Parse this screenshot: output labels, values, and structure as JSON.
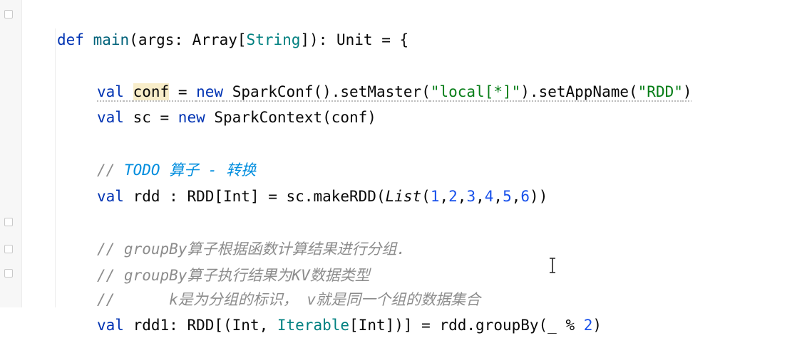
{
  "editor": {
    "line1": {
      "kw_def": "def",
      "name": "main",
      "rest1": "(args: Array[",
      "type_string": "String",
      "rest2": "]): Unit = {"
    },
    "line2": {
      "kw_val": "val",
      "var": "conf",
      "eq": " = ",
      "kw_new": "new",
      "call1": " SparkConf().setMaster(",
      "str1": "\"local[*]\"",
      "call2": ").setAppName(",
      "str2": "\"RDD\"",
      "close": ")"
    },
    "line3": {
      "kw_val": "val",
      "mid": " sc = ",
      "kw_new": "new",
      "rest": " SparkContext(conf)"
    },
    "line4": {
      "slash": "// ",
      "todo": "TODO 算子 - 转换"
    },
    "line5": {
      "kw_val": "val",
      "mid": " rdd : RDD[Int] = sc.makeRDD(",
      "list": "List",
      "open": "(",
      "nums": [
        "1",
        "2",
        "3",
        "4",
        "5",
        "6"
      ],
      "close": "))"
    },
    "line6": {
      "comment": "// groupBy算子根据函数计算结果进行分组."
    },
    "line7": {
      "comment": "// groupBy算子执行结果为KV数据类型"
    },
    "line8": {
      "comment": "//      k是为分组的标识， v就是同一个组的数据集合"
    },
    "line9": {
      "kw_val": "val",
      "mid": " rdd1: RDD[(Int, ",
      "iterable": "Iterable",
      "rest": "[Int])] = rdd.groupBy(_ % ",
      "num": "2",
      "close": ")"
    }
  },
  "icons": {
    "fold": "fold-marker-icon",
    "cursor": "text-cursor-icon"
  }
}
